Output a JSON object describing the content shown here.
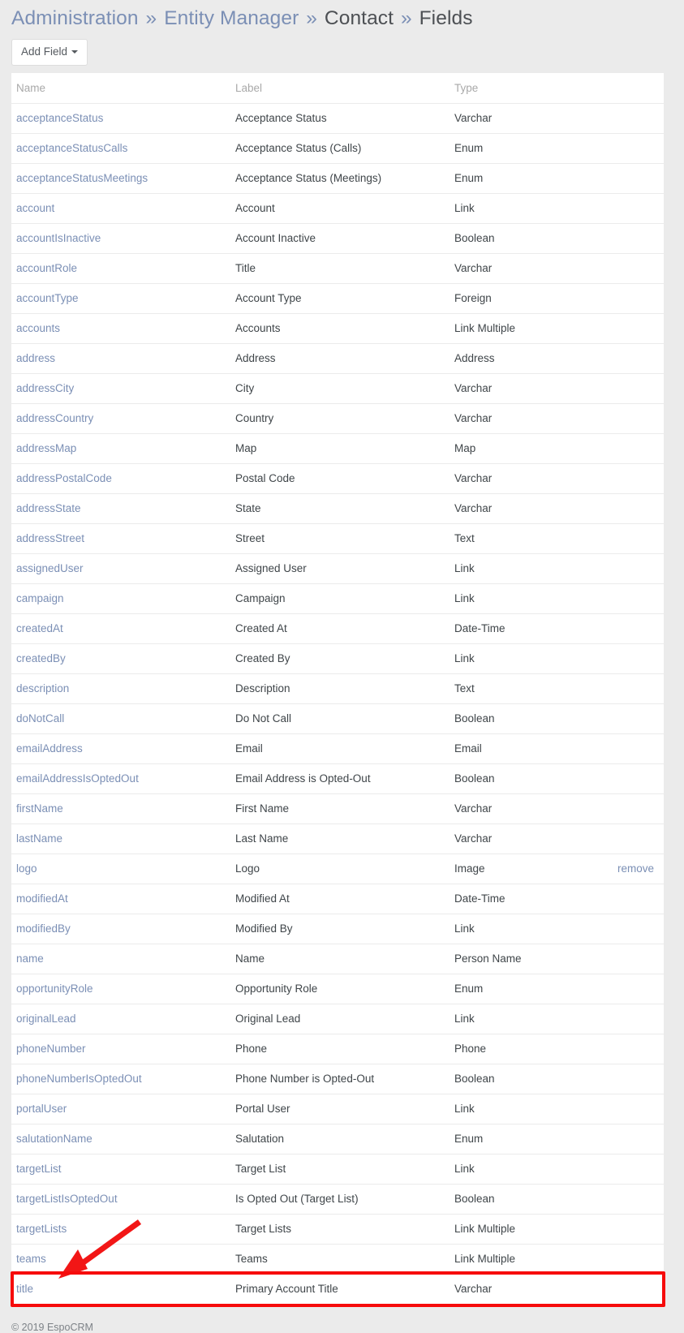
{
  "breadcrumb": {
    "items": [
      {
        "label": "Administration",
        "link": true
      },
      {
        "label": "Entity Manager",
        "link": true
      },
      {
        "label": "Contact",
        "link": false
      },
      {
        "label": "Fields",
        "link": false
      }
    ],
    "separator": "»"
  },
  "toolbar": {
    "add_field_label": "Add Field"
  },
  "table": {
    "columns": [
      "Name",
      "Label",
      "Type"
    ],
    "rows": [
      {
        "name": "acceptanceStatus",
        "label": "Acceptance Status",
        "type": "Varchar"
      },
      {
        "name": "acceptanceStatusCalls",
        "label": "Acceptance Status (Calls)",
        "type": "Enum"
      },
      {
        "name": "acceptanceStatusMeetings",
        "label": "Acceptance Status (Meetings)",
        "type": "Enum"
      },
      {
        "name": "account",
        "label": "Account",
        "type": "Link"
      },
      {
        "name": "accountIsInactive",
        "label": "Account Inactive",
        "type": "Boolean"
      },
      {
        "name": "accountRole",
        "label": "Title",
        "type": "Varchar"
      },
      {
        "name": "accountType",
        "label": "Account Type",
        "type": "Foreign"
      },
      {
        "name": "accounts",
        "label": "Accounts",
        "type": "Link Multiple"
      },
      {
        "name": "address",
        "label": "Address",
        "type": "Address"
      },
      {
        "name": "addressCity",
        "label": "City",
        "type": "Varchar"
      },
      {
        "name": "addressCountry",
        "label": "Country",
        "type": "Varchar"
      },
      {
        "name": "addressMap",
        "label": "Map",
        "type": "Map"
      },
      {
        "name": "addressPostalCode",
        "label": "Postal Code",
        "type": "Varchar"
      },
      {
        "name": "addressState",
        "label": "State",
        "type": "Varchar"
      },
      {
        "name": "addressStreet",
        "label": "Street",
        "type": "Text"
      },
      {
        "name": "assignedUser",
        "label": "Assigned User",
        "type": "Link"
      },
      {
        "name": "campaign",
        "label": "Campaign",
        "type": "Link"
      },
      {
        "name": "createdAt",
        "label": "Created At",
        "type": "Date-Time"
      },
      {
        "name": "createdBy",
        "label": "Created By",
        "type": "Link"
      },
      {
        "name": "description",
        "label": "Description",
        "type": "Text"
      },
      {
        "name": "doNotCall",
        "label": "Do Not Call",
        "type": "Boolean"
      },
      {
        "name": "emailAddress",
        "label": "Email",
        "type": "Email"
      },
      {
        "name": "emailAddressIsOptedOut",
        "label": "Email Address is Opted-Out",
        "type": "Boolean"
      },
      {
        "name": "firstName",
        "label": "First Name",
        "type": "Varchar"
      },
      {
        "name": "lastName",
        "label": "Last Name",
        "type": "Varchar"
      },
      {
        "name": "logo",
        "label": "Logo",
        "type": "Image",
        "action": "remove"
      },
      {
        "name": "modifiedAt",
        "label": "Modified At",
        "type": "Date-Time"
      },
      {
        "name": "modifiedBy",
        "label": "Modified By",
        "type": "Link"
      },
      {
        "name": "name",
        "label": "Name",
        "type": "Person Name"
      },
      {
        "name": "opportunityRole",
        "label": "Opportunity Role",
        "type": "Enum"
      },
      {
        "name": "originalLead",
        "label": "Original Lead",
        "type": "Link"
      },
      {
        "name": "phoneNumber",
        "label": "Phone",
        "type": "Phone"
      },
      {
        "name": "phoneNumberIsOptedOut",
        "label": "Phone Number is Opted-Out",
        "type": "Boolean"
      },
      {
        "name": "portalUser",
        "label": "Portal User",
        "type": "Link"
      },
      {
        "name": "salutationName",
        "label": "Salutation",
        "type": "Enum"
      },
      {
        "name": "targetList",
        "label": "Target List",
        "type": "Link"
      },
      {
        "name": "targetListIsOptedOut",
        "label": "Is Opted Out (Target List)",
        "type": "Boolean"
      },
      {
        "name": "targetLists",
        "label": "Target Lists",
        "type": "Link Multiple"
      },
      {
        "name": "teams",
        "label": "Teams",
        "type": "Link Multiple"
      },
      {
        "name": "title",
        "label": "Primary Account Title",
        "type": "Varchar",
        "highlighted": true
      }
    ]
  },
  "annotation": {
    "highlight_color": "#f60b0b",
    "arrow_color": "#f21616",
    "target_row_name": "title"
  },
  "footer": {
    "copyright": "© 2019 EspoCRM"
  },
  "colors": {
    "page_background": "#ebebeb",
    "link": "#7b8fb5",
    "text": "#3f4549",
    "header_text": "#a9a9a9",
    "row_border": "#ebebeb"
  }
}
